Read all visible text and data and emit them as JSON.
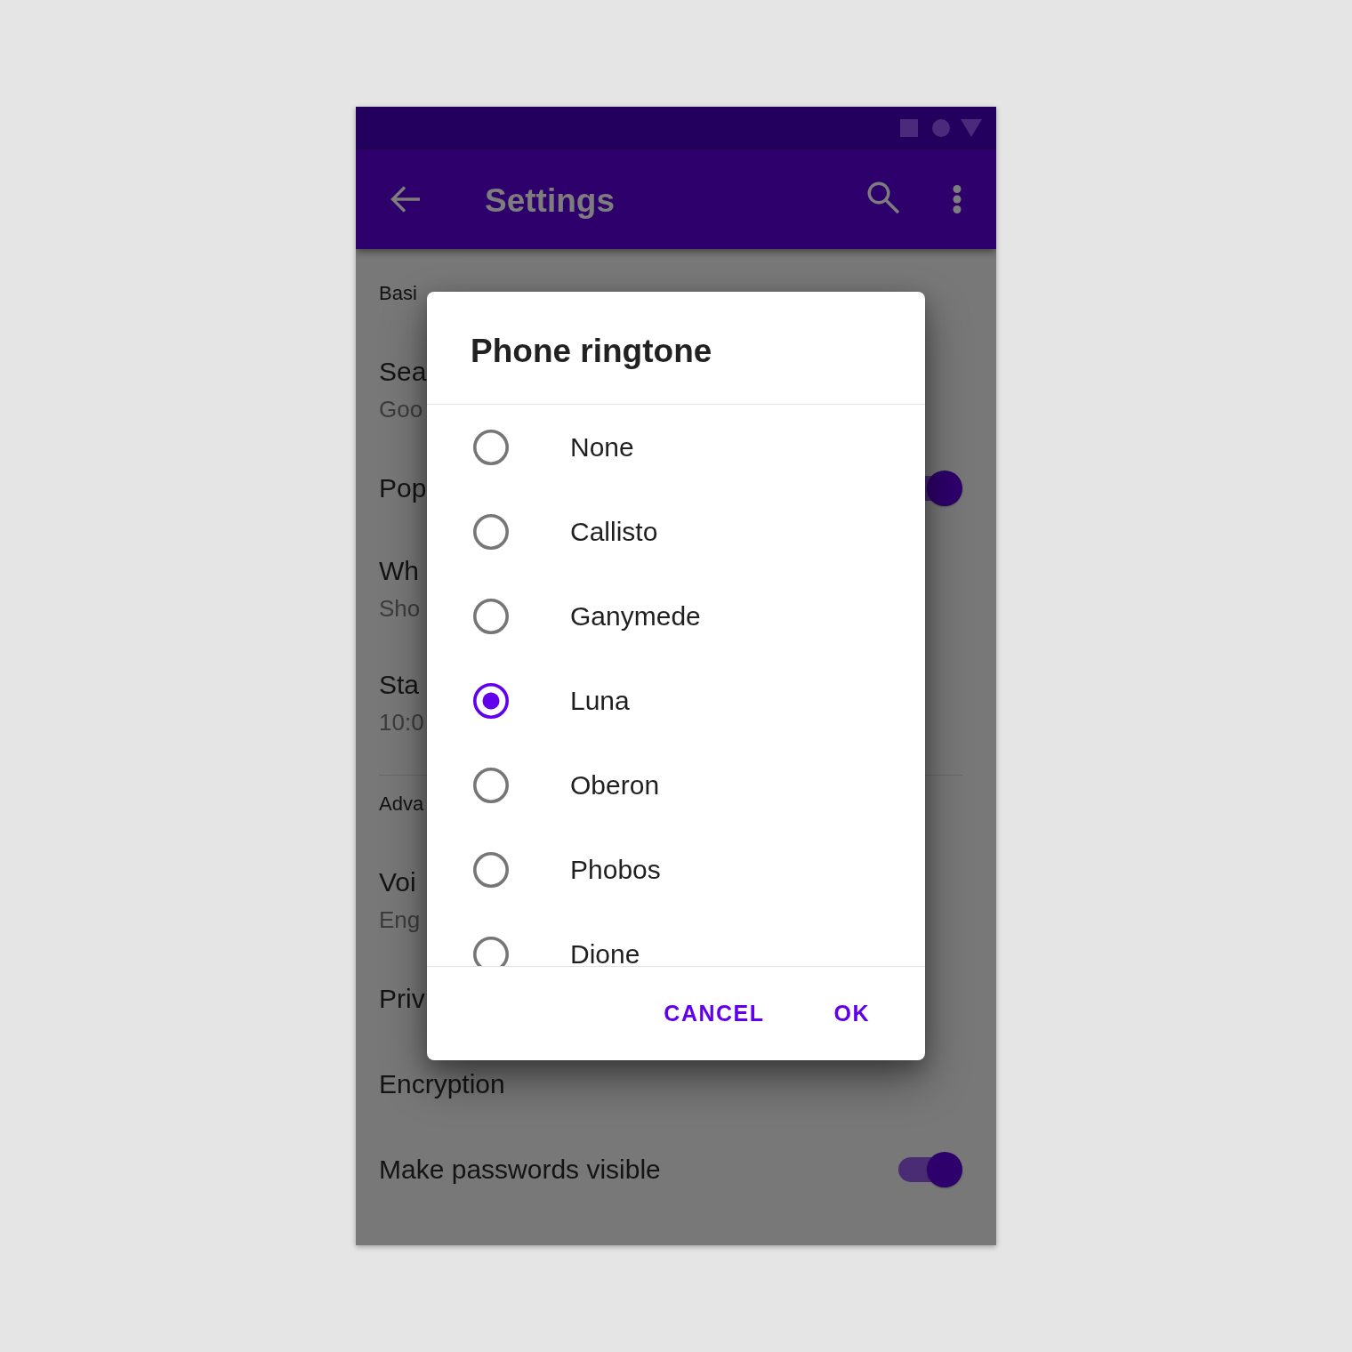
{
  "app_bar": {
    "title": "Settings"
  },
  "settings": {
    "sections": [
      {
        "header": "Basi",
        "items": [
          {
            "kind": "text",
            "title": "Sea",
            "subtitle": "Goo"
          },
          {
            "kind": "switch",
            "title": "Pop",
            "on": true
          },
          {
            "kind": "text",
            "title": "Wh",
            "subtitle": "Sho"
          },
          {
            "kind": "text",
            "title": "Sta",
            "subtitle": "10:0"
          }
        ]
      },
      {
        "header": "Adva",
        "items": [
          {
            "kind": "text",
            "title": "Voi",
            "subtitle": "Eng"
          },
          {
            "kind": "text",
            "title": "Priv"
          },
          {
            "kind": "text",
            "title": "Encryption"
          },
          {
            "kind": "switch",
            "title": "Make passwords visible",
            "on": true
          }
        ]
      }
    ]
  },
  "dialog": {
    "title": "Phone ringtone",
    "options": [
      {
        "label": "None",
        "selected": false
      },
      {
        "label": "Callisto",
        "selected": false
      },
      {
        "label": "Ganymede",
        "selected": false
      },
      {
        "label": "Luna",
        "selected": true
      },
      {
        "label": "Oberon",
        "selected": false
      },
      {
        "label": "Phobos",
        "selected": false
      },
      {
        "label": "Dione",
        "selected": false
      }
    ],
    "buttons": [
      "CANCEL",
      "OK"
    ]
  }
}
